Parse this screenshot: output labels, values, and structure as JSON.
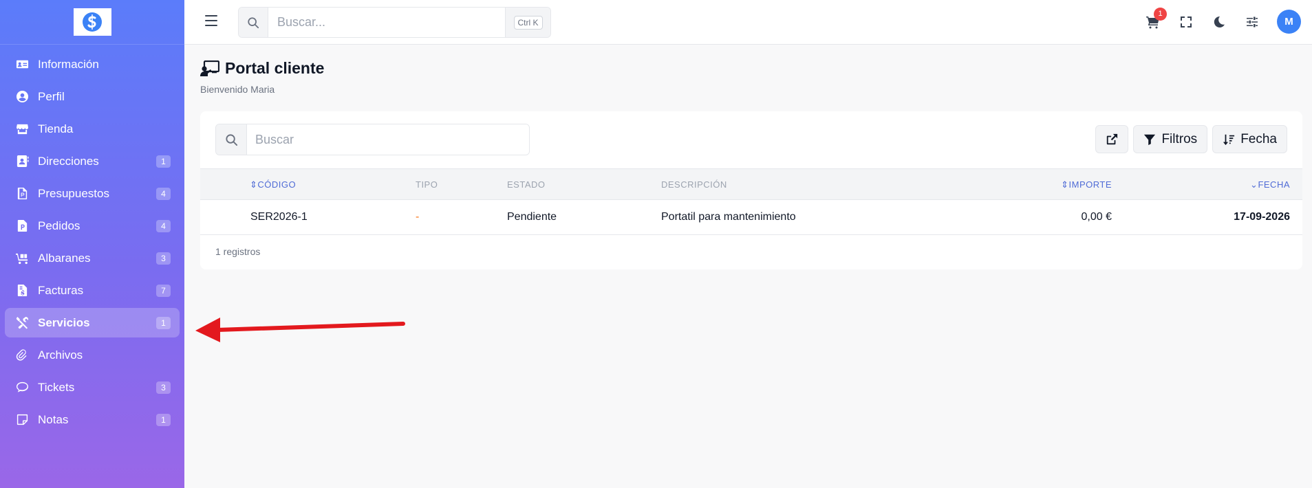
{
  "sidebar": {
    "items": [
      {
        "label": "Información",
        "icon": "id-card-icon",
        "badge": null
      },
      {
        "label": "Perfil",
        "icon": "user-circle-icon",
        "badge": null
      },
      {
        "label": "Tienda",
        "icon": "store-icon",
        "badge": null
      },
      {
        "label": "Direcciones",
        "icon": "address-book-icon",
        "badge": "1"
      },
      {
        "label": "Presupuestos",
        "icon": "file-invoice-icon",
        "badge": "4"
      },
      {
        "label": "Pedidos",
        "icon": "file-document-icon",
        "badge": "4"
      },
      {
        "label": "Albaranes",
        "icon": "dolly-icon",
        "badge": "3"
      },
      {
        "label": "Facturas",
        "icon": "invoice-dollar-icon",
        "badge": "7"
      },
      {
        "label": "Servicios",
        "icon": "tools-icon",
        "badge": "1",
        "active": true
      },
      {
        "label": "Archivos",
        "icon": "paperclip-icon",
        "badge": null
      },
      {
        "label": "Tickets",
        "icon": "chat-icon",
        "badge": "3"
      },
      {
        "label": "Notas",
        "icon": "note-icon",
        "badge": "1"
      }
    ]
  },
  "topbar": {
    "search_placeholder": "Buscar...",
    "shortcut": "Ctrl K",
    "cart_count": "1",
    "avatar_initial": "M"
  },
  "page": {
    "title": "Portal cliente",
    "subtitle": "Bienvenido Maria"
  },
  "card": {
    "search_placeholder": "Buscar",
    "filters_label": "Filtros",
    "date_label": "Fecha"
  },
  "table": {
    "headers": {
      "codigo": "CÓDIGO",
      "tipo": "TIPO",
      "estado": "ESTADO",
      "descripcion": "DESCRIPCIÓN",
      "importe": "IMPORTE",
      "fecha": "FECHA"
    },
    "rows": [
      {
        "codigo": "SER2026-1",
        "tipo": "-",
        "estado": "Pendiente",
        "descripcion": "Portatil para mantenimiento",
        "importe": "0,00 €",
        "fecha": "17-09-2026"
      }
    ],
    "records": "1 registros"
  },
  "colors": {
    "sidebar_top": "#5b7cfa",
    "sidebar_bottom": "#9a67e8",
    "accent": "#3b82f6",
    "sort_header": "#4f6bd6",
    "annotation_arrow": "#e3191e",
    "cart_badge": "#ef4444"
  }
}
